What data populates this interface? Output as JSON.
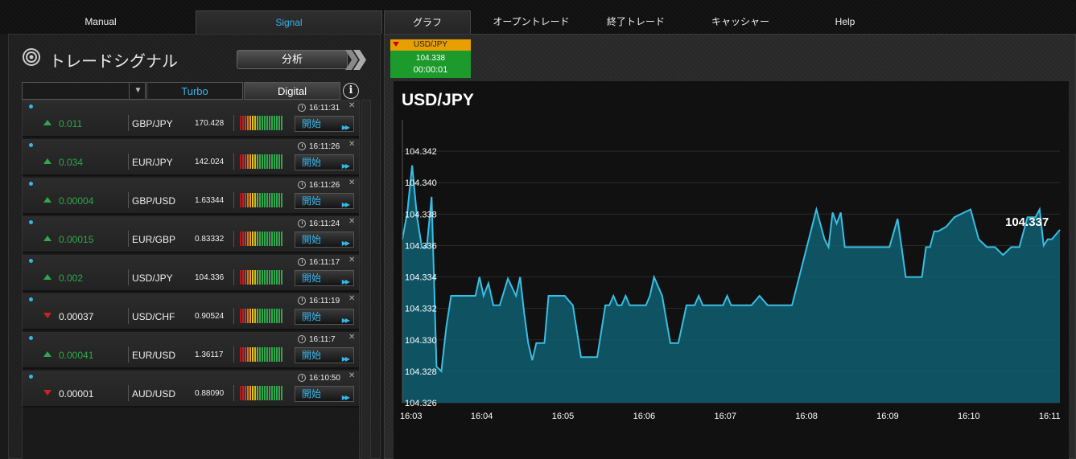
{
  "nav": {
    "items": [
      {
        "label": "Manual"
      },
      {
        "label": "Signal"
      },
      {
        "label": "グラフ"
      },
      {
        "label": "オープントレード"
      },
      {
        "label": "終了トレード"
      },
      {
        "label": "キャッシャー"
      },
      {
        "label": "Help"
      }
    ]
  },
  "panel": {
    "title": "トレードシグナル",
    "analyze_label": "分析",
    "filter_value": "",
    "turbo_label": "Turbo",
    "digital_label": "Digital",
    "info_label": "i"
  },
  "signals": [
    {
      "time": "16:11:31",
      "direction": "up",
      "change": "0.011",
      "pair": "GBP/JPY",
      "price": "170.428",
      "start": "開始"
    },
    {
      "time": "16:11:26",
      "direction": "up",
      "change": "0.034",
      "pair": "EUR/JPY",
      "price": "142.024",
      "start": "開始"
    },
    {
      "time": "16:11:26",
      "direction": "up",
      "change": "0.00004",
      "pair": "GBP/USD",
      "price": "1.63344",
      "start": "開始"
    },
    {
      "time": "16:11:24",
      "direction": "up",
      "change": "0.00015",
      "pair": "EUR/GBP",
      "price": "0.83332",
      "start": "開始"
    },
    {
      "time": "16:11:17",
      "direction": "up",
      "change": "0.002",
      "pair": "USD/JPY",
      "price": "104.336",
      "start": "開始"
    },
    {
      "time": "16:11:19",
      "direction": "down",
      "change": "0.00037",
      "pair": "USD/CHF",
      "price": "0.90524",
      "start": "開始"
    },
    {
      "time": "16:11:7",
      "direction": "up",
      "change": "0.00041",
      "pair": "EUR/USD",
      "price": "1.36117",
      "start": "開始"
    },
    {
      "time": "16:10:50",
      "direction": "down",
      "change": "0.00001",
      "pair": "AUD/USD",
      "price": "0.88090",
      "start": "開始"
    }
  ],
  "mini_tile": {
    "pair": "USD/JPY",
    "price": "104.338",
    "timer": "00:00:01"
  },
  "chart": {
    "title": "USD/JPY",
    "last_price": "104.337",
    "colors": {
      "line": "#3bbde3",
      "fill": "#0f5f72",
      "grid": "#2a2a2a",
      "text": "#ffffff"
    }
  },
  "chart_data": {
    "type": "area",
    "title": "USD/JPY",
    "xlabel": "",
    "ylabel": "",
    "ylim": [
      104.326,
      104.344
    ],
    "xlim": [
      "16:03",
      "16:11"
    ],
    "x_ticks": [
      "16:03",
      "16:04",
      "16:05",
      "16:06",
      "16:07",
      "16:08",
      "16:09",
      "16:10",
      "16:11"
    ],
    "y_ticks": [
      "104.326",
      "104.328",
      "104.330",
      "104.332",
      "104.334",
      "104.336",
      "104.338",
      "104.340",
      "104.342"
    ],
    "grid": true,
    "series": [
      {
        "x": [
          0.0,
          0.06,
          0.12,
          0.18,
          0.24,
          0.3,
          0.36,
          0.42,
          0.48,
          0.54,
          0.6,
          0.7,
          0.8,
          0.9,
          0.95,
          1.0,
          1.06,
          1.12,
          1.2,
          1.3,
          1.4,
          1.45,
          1.5,
          1.55,
          1.6,
          1.65,
          1.7,
          1.75,
          1.8,
          1.9,
          2.0,
          2.1,
          2.2,
          2.4,
          2.5,
          2.55,
          2.6,
          2.65,
          2.7,
          2.75,
          2.8,
          2.9,
          3.0,
          3.05,
          3.1,
          3.2,
          3.3,
          3.4,
          3.5,
          3.6,
          3.65,
          3.7,
          3.8,
          3.9,
          3.95,
          4.0,
          4.05,
          4.1,
          4.2,
          4.3,
          4.4,
          4.5,
          4.8,
          5.1,
          5.2,
          5.25,
          5.3,
          5.35,
          5.4,
          5.45,
          5.5,
          5.6,
          5.8,
          6.0,
          6.1,
          6.15,
          6.2,
          6.3,
          6.4,
          6.45,
          6.5,
          6.55,
          6.6,
          6.7,
          6.8,
          7.0,
          7.1,
          7.2,
          7.3,
          7.4,
          7.5,
          7.6,
          7.7,
          7.8,
          7.85,
          7.9,
          7.95,
          8.0,
          8.1
        ],
        "y": [
          104.3364,
          104.3381,
          104.3411,
          104.3378,
          104.3359,
          104.3359,
          104.3391,
          104.3283,
          104.328,
          104.3308,
          104.3328,
          104.3328,
          104.3328,
          104.3328,
          104.334,
          104.3328,
          104.3336,
          104.3322,
          104.3322,
          104.3339,
          104.3328,
          104.334,
          104.3317,
          104.3298,
          104.3287,
          104.3298,
          104.3298,
          104.3298,
          104.3328,
          104.3328,
          104.3328,
          104.3322,
          104.3289,
          104.3289,
          104.3322,
          104.3322,
          104.3328,
          104.3322,
          104.3322,
          104.3328,
          104.3322,
          104.3322,
          104.3322,
          104.3328,
          104.334,
          104.3328,
          104.3298,
          104.3298,
          104.3322,
          104.3322,
          104.3328,
          104.3322,
          104.3322,
          104.3322,
          104.3322,
          104.3328,
          104.3322,
          104.3322,
          104.3322,
          104.3322,
          104.3328,
          104.3322,
          104.3322,
          104.3383,
          104.3364,
          104.3359,
          104.3381,
          104.3374,
          104.3381,
          104.3359,
          104.3359,
          104.3359,
          104.3359,
          104.3359,
          104.3377,
          104.3359,
          104.334,
          104.334,
          104.334,
          104.3359,
          104.3359,
          104.3369,
          104.3369,
          104.3372,
          104.3378,
          104.3383,
          104.3364,
          104.3359,
          104.3359,
          104.3354,
          104.3359,
          104.3359,
          104.3378,
          104.3378,
          104.3383,
          104.336,
          104.3364,
          104.3364,
          104.337
        ]
      }
    ]
  }
}
